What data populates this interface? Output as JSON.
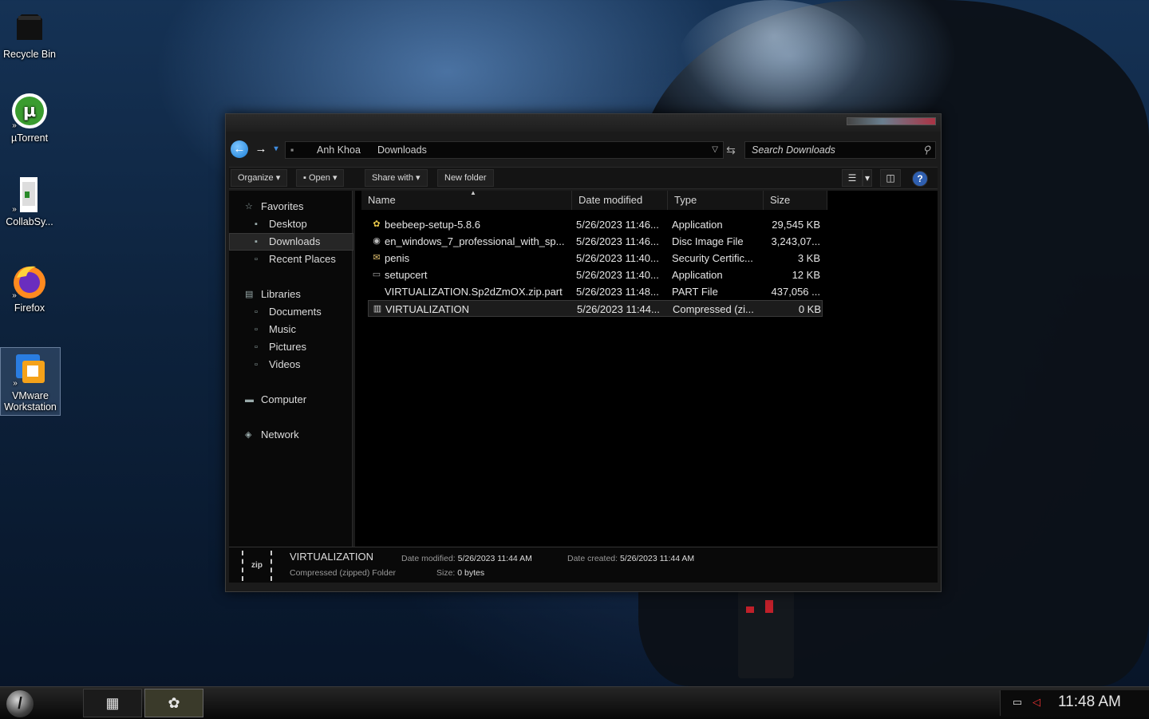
{
  "desktop": {
    "icons": [
      {
        "label": "Recycle Bin",
        "icon": "recycle-bin-icon"
      },
      {
        "label": "µTorrent",
        "icon": "utorrent-icon"
      },
      {
        "label": "CollabSy...",
        "icon": "collabsync-icon"
      },
      {
        "label": "Firefox",
        "icon": "firefox-icon"
      },
      {
        "label": "VMware Workstation",
        "icon": "vmware-icon"
      }
    ]
  },
  "explorer": {
    "breadcrumb": [
      "Anh Khoa",
      "Downloads"
    ],
    "search_placeholder": "Search Downloads",
    "toolbar": {
      "organize": "Organize",
      "open": "Open",
      "share_with": "Share with",
      "new_folder": "New folder"
    },
    "nav": {
      "favorites": "Favorites",
      "desktop": "Desktop",
      "downloads": "Downloads",
      "recent_places": "Recent Places",
      "libraries": "Libraries",
      "documents": "Documents",
      "music": "Music",
      "pictures": "Pictures",
      "videos": "Videos",
      "computer": "Computer",
      "network": "Network"
    },
    "columns": {
      "name": "Name",
      "date_modified": "Date modified",
      "type": "Type",
      "size": "Size"
    },
    "files": [
      {
        "name": "beebeep-setup-5.8.6",
        "date": "5/26/2023 11:46...",
        "type": "Application",
        "size": "29,545 KB"
      },
      {
        "name": "en_windows_7_professional_with_sp...",
        "date": "5/26/2023 11:46...",
        "type": "Disc Image File",
        "size": "3,243,07..."
      },
      {
        "name": "penis",
        "date": "5/26/2023 11:40...",
        "type": "Security Certific...",
        "size": "3 KB"
      },
      {
        "name": "setupcert",
        "date": "5/26/2023 11:40...",
        "type": "Application",
        "size": "12 KB"
      },
      {
        "name": "VIRTUALIZATION.Sp2dZmOX.zip.part",
        "date": "5/26/2023 11:48...",
        "type": "PART File",
        "size": "437,056 ..."
      },
      {
        "name": "VIRTUALIZATION",
        "date": "5/26/2023 11:44...",
        "type": "Compressed (zi...",
        "size": "0 KB"
      }
    ],
    "details": {
      "thumb": "zip",
      "name": "VIRTUALIZATION",
      "type": "Compressed (zipped) Folder",
      "modified_label": "Date modified:",
      "modified_value": "5/26/2023 11:44 AM",
      "created_label": "Date created:",
      "created_value": "5/26/2023 11:44 AM",
      "size_label": "Size:",
      "size_value": "0 bytes"
    }
  },
  "taskbar": {
    "clock": "11:48 AM"
  }
}
